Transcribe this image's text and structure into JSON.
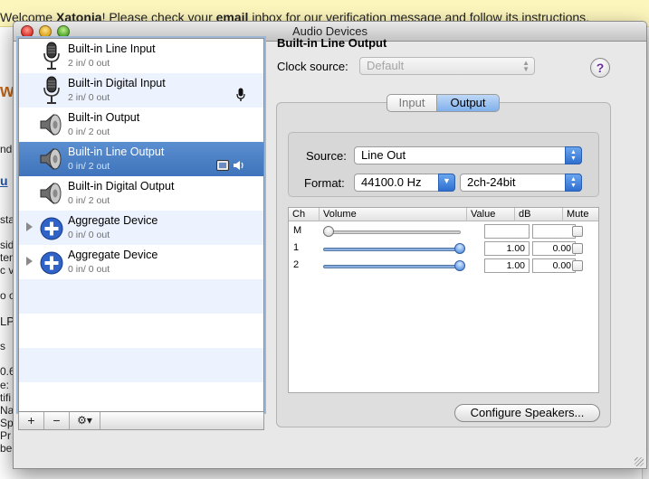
{
  "background": {
    "banner_parts": [
      "Welcome ",
      "Xatonia",
      "! Please check your ",
      "email",
      " inbox for our verification message and follow its instructions."
    ],
    "fragments": [
      "w",
      "nd",
      "u",
      "sta",
      "side",
      "ten",
      "c vo",
      "o o",
      "LP",
      "s",
      "0.6",
      "e:",
      "tifi",
      "Na",
      "Spe",
      "Pr",
      "ber"
    ]
  },
  "window": {
    "title": "Audio Devices"
  },
  "devices": [
    {
      "name": "Built-in Line Input",
      "io": "2 in/ 0 out",
      "icon": "microphone-icon"
    },
    {
      "name": "Built-in Digital Input",
      "io": "2 in/ 0 out",
      "icon": "microphone-icon",
      "badge": "default-input-mic-icon"
    },
    {
      "name": "Built-in Output",
      "io": "0 in/ 2 out",
      "icon": "speaker-icon"
    },
    {
      "name": "Built-in Line Output",
      "io": "0 in/ 2 out",
      "icon": "speaker-icon",
      "selected": true,
      "badges": [
        "finder-system-output-icon",
        "speaker-volume-icon"
      ]
    },
    {
      "name": "Built-in Digital Output",
      "io": "0 in/ 2 out",
      "icon": "speaker-icon"
    },
    {
      "name": "Aggregate Device",
      "io": "0 in/ 0 out",
      "icon": "plus-circle-icon",
      "expandable": true
    },
    {
      "name": "Aggregate Device",
      "io": "0 in/ 0 out",
      "icon": "plus-circle-icon",
      "expandable": true
    }
  ],
  "list_toolbar": {
    "add_label": "+",
    "remove_label": "−",
    "gear_label": "⚙▾"
  },
  "detail": {
    "title": "Built-in Line Output",
    "clock_source_label": "Clock source:",
    "clock_source_value": "Default",
    "help_label": "?",
    "tabs": [
      {
        "label": "Input",
        "active": false
      },
      {
        "label": "Output",
        "active": true
      }
    ],
    "source_label": "Source:",
    "source_value": "Line Out",
    "format_label": "Format:",
    "format_rate": "44100.0 Hz",
    "format_bits": "2ch-24bit",
    "table": {
      "headers": [
        "Ch",
        "Volume",
        "Value",
        "dB",
        "Mute"
      ],
      "rows": [
        {
          "ch": "M",
          "volume": 0.0,
          "value": "",
          "db": "",
          "enabled": false
        },
        {
          "ch": "1",
          "volume": 1.0,
          "value": "1.00",
          "db": "0.00",
          "enabled": true
        },
        {
          "ch": "2",
          "volume": 1.0,
          "value": "1.00",
          "db": "0.00",
          "enabled": true
        }
      ]
    },
    "configure_label": "Configure Speakers..."
  },
  "colors": {
    "selection": "#4a80c6",
    "row_alt": "#edf3fe",
    "accent_blue": "#3f7ed6",
    "help_purple": "#6a2f9e"
  }
}
